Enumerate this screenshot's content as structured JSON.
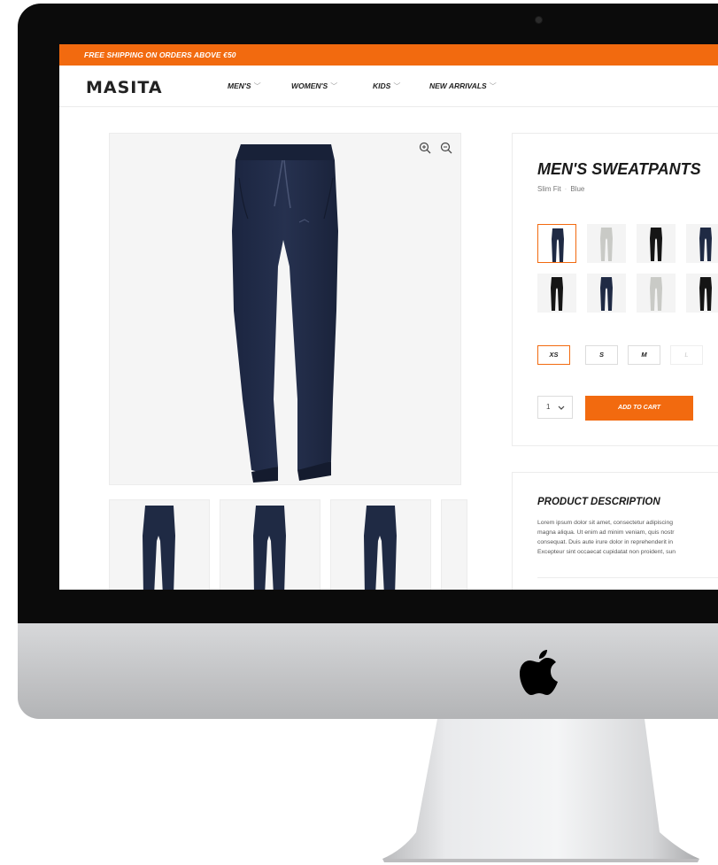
{
  "promo": {
    "text": "FREE SHIPPING ON ORDERS ABOVE €50"
  },
  "brand": {
    "logo_text": "MASITA"
  },
  "nav": {
    "items": [
      {
        "label": "MEN'S"
      },
      {
        "label": "WOMEN'S"
      },
      {
        "label": "KIDS"
      },
      {
        "label": "NEW ARRIVALS"
      }
    ],
    "chevron": "﹀"
  },
  "product": {
    "title": "MEN'S SWEATPANTS",
    "fit": "Slim Fit",
    "color": "Blue",
    "color_swatches": [
      {
        "pants": "#1f2a44",
        "selected": true
      },
      {
        "pants": "#c9cac6",
        "selected": false
      },
      {
        "pants": "#151515",
        "selected": false
      },
      {
        "pants": "#1f2a44",
        "selected": false
      },
      {
        "pants": "#151515",
        "selected": false
      },
      {
        "pants": "#1f2a44",
        "selected": false
      },
      {
        "pants": "#c9cac6",
        "selected": false
      },
      {
        "pants": "#151515",
        "selected": false
      }
    ],
    "sizes": [
      {
        "label": "XS",
        "state": "selected"
      },
      {
        "label": "S",
        "state": "available"
      },
      {
        "label": "M",
        "state": "available"
      },
      {
        "label": "L",
        "state": "disabled"
      }
    ],
    "quantity": "1",
    "add_to_cart_label": "ADD TO CART"
  },
  "description": {
    "title": "PRODUCT DESCRIPTION",
    "lines": [
      "Lorem ipsum dolor sit amet, consectetur adipiscing",
      "magna aliqua. Ut enim ad minim veniam, quis nostr",
      "consequat. Duis aute irure dolor in reprehenderit in",
      "Excepteur sint occaecat cupidatat non proident, sun"
    ]
  },
  "icons": {
    "zoom_in": "zoom-in-icon",
    "zoom_out": "zoom-out-icon",
    "quantity_dropdown": "chevron-down-icon",
    "brand_mark": "apple-logo-icon"
  },
  "colors": {
    "accent": "#f26a0f",
    "pants_navy": "#1f2a44",
    "text_dark": "#1a1a1a"
  }
}
